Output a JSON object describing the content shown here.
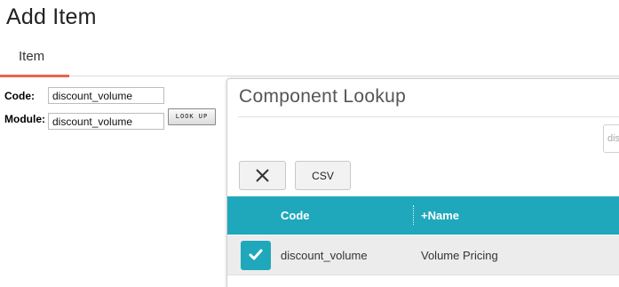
{
  "page": {
    "title": "Add Item"
  },
  "tabs": [
    {
      "label": "Item",
      "active": true
    }
  ],
  "form": {
    "code_label": "Code:",
    "code_value": "discount_volume",
    "module_label": "Module:",
    "module_value": "discount_volume",
    "lookup_button": "LOOK UP"
  },
  "dialog": {
    "title": "Component Lookup",
    "search_value": "dis",
    "toolbar": {
      "close_icon": "close-icon",
      "csv_label": "CSV"
    },
    "columns": [
      "Code",
      "+Name"
    ],
    "rows": [
      {
        "selected": true,
        "code": "discount_volume",
        "name": "Volume Pricing"
      }
    ]
  },
  "colors": {
    "accent": "#1fa8bc",
    "tab_underline": "#f0604c"
  }
}
